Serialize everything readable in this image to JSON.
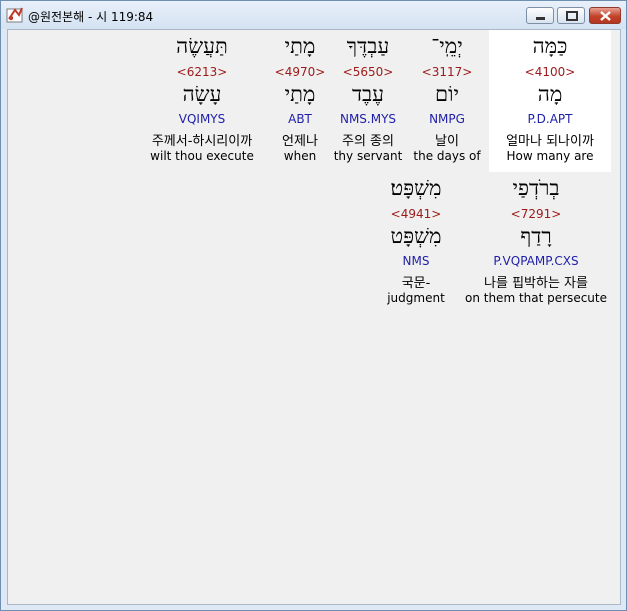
{
  "window": {
    "title": "@원전본해 - 시 119:84"
  },
  "words": [
    {
      "hebrew": "כַּמָּה",
      "strong": "<4100>",
      "lemma": "מָה",
      "morph": "P.D.APT",
      "korean": "얼마나 되나이까",
      "english": "How many are",
      "highlighted": true
    },
    {
      "hebrew": "יְמֵֽי־",
      "strong": "<3117>",
      "lemma": "יוֹם",
      "morph": "NMPG",
      "korean": "날이",
      "english": "the days of"
    },
    {
      "hebrew": "עַבְדֶּךָ",
      "strong": "<5650>",
      "lemma": "עֶבֶד",
      "morph": "NMS.MYS",
      "korean": "주의 종의",
      "english": "thy servant"
    },
    {
      "hebrew": "מָתַי",
      "strong": "<4970>",
      "lemma": "מָתַי",
      "morph": "ABT",
      "korean": "언제나",
      "english": "when"
    },
    {
      "hebrew": "תַּעֲשֶׂה",
      "strong": "<6213>",
      "lemma": "עָשָׂה",
      "morph": "VQIMYS",
      "korean": "주께서-하시리이까",
      "english": "wilt thou execute"
    },
    {
      "hebrew": "בְרֹדְפַי",
      "strong": "<7291>",
      "lemma": "רָדַף",
      "morph": "P.VQPAMP.CXS",
      "korean": "나를 핍박하는 자를",
      "english": "on them that persecute"
    },
    {
      "hebrew": "מִשְׁפָּט׃",
      "strong": "<4941>",
      "lemma": "מִשְׁפָּט",
      "morph": "NMS",
      "korean": "국문-",
      "english": "judgment"
    }
  ]
}
